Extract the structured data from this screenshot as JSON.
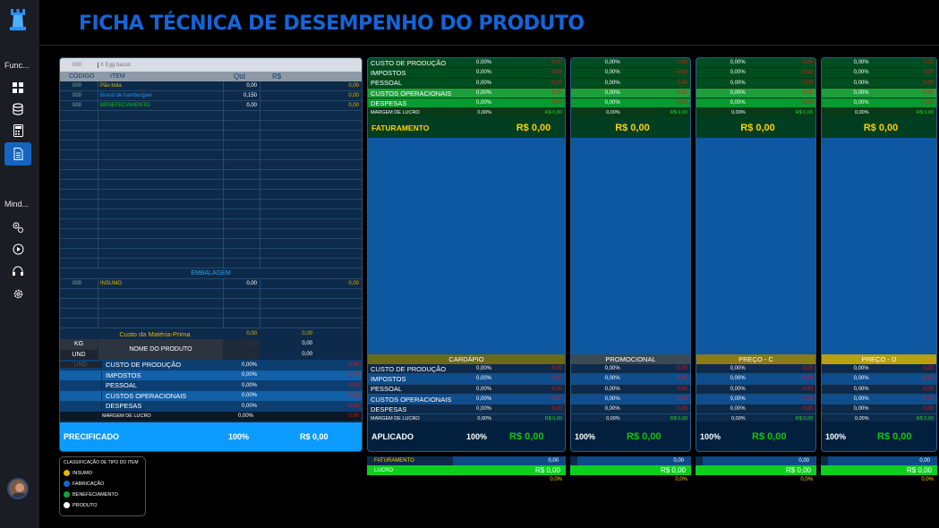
{
  "title": "FICHA TÉCNICA DE DESEMPENHO DO PRODUTO",
  "sidebar": {
    "section1": "Func...",
    "section2": "Mind...",
    "icons1": [
      "grid-icon",
      "database-icon",
      "calculator-icon",
      "document-icon"
    ],
    "icons2": [
      "gears-icon",
      "play-icon",
      "headset-icon",
      "settings-icon"
    ]
  },
  "left_panel": {
    "search_code": "000",
    "search_text": "X Egg bacon",
    "headers": {
      "code": "CÓDIGO",
      "item": "ITEM",
      "qtd": "Qtd",
      "rs": "R$"
    },
    "items": [
      {
        "code": "000",
        "item": "Pão bola",
        "qtd": "0,00",
        "rs": "0,00",
        "color": "#e3b800"
      },
      {
        "code": "000",
        "item": "Brand de hamburguer",
        "qtd": "0,150",
        "rs": "0,00",
        "color": "#2a8ff0"
      },
      {
        "code": "000",
        "item": "BENEFECIAMENTO",
        "qtd": "0,00",
        "rs": "0,00",
        "color": "#11c411"
      }
    ],
    "embalagem_label": "EMBALAGEM",
    "embalagem_items": [
      {
        "code": "000",
        "item": "INSUMO",
        "qtd": "0,00",
        "rs": "0,00"
      }
    ],
    "custo_mp": {
      "label": "Custo da Matéria-Prima",
      "qtd": "0,00",
      "rs": "0,00"
    },
    "unit_labels": [
      "KG",
      "UND",
      "UND"
    ],
    "nome_produto": "NOME DO PRODUTO",
    "kg_values": [
      "0,00",
      "0,00"
    ],
    "und_values": [
      "1",
      "0,00"
    ],
    "costs": [
      {
        "label": "CUSTO DE PRODUÇÃO",
        "pct": "0,00%",
        "val": "0,00"
      },
      {
        "label": "IMPOSTOS",
        "pct": "0,00%",
        "val": "0,00"
      },
      {
        "label": "PESSOAL",
        "pct": "0,00%",
        "val": "0,00"
      },
      {
        "label": "CUSTOS OPERACIONAIS",
        "pct": "0,00%",
        "val": "0,00"
      },
      {
        "label": "DESPESAS",
        "pct": "0,00%",
        "val": "0,00"
      }
    ],
    "margem": {
      "label": "MARGEM DE LUCRO",
      "pct": "0,00%",
      "val": "0,00"
    },
    "footer": {
      "label": "PRECIFICADO",
      "pct": "100%",
      "val": "R$ 0,00"
    }
  },
  "price_columns": [
    {
      "labels": [
        "CUSTO DE PRODUÇÃO",
        "IMPOSTOS",
        "PESSOAL",
        "CUSTOS OPERACIONAIS",
        "DESPESAS"
      ],
      "pcts": [
        "0,00%",
        "0,00%",
        "0,00%",
        "0,00%",
        "0,00%"
      ],
      "vals": [
        "0,00",
        "0,00",
        "0,00",
        "0,00",
        "0,00"
      ],
      "margem_label": "MARGEM DE LUCRO",
      "margem_pct": "0,00%",
      "margem_val": "R$ 0,00",
      "fat_label": "FATURAMENTO",
      "fat_val": "R$ 0,00",
      "bar_title": "CARDÁPIO",
      "bar_color": "#6b6a1a",
      "lower_pcts": [
        "0,00%",
        "0,00%",
        "0,00%",
        "0,00%",
        "0,00%"
      ],
      "lower_vals": [
        "0,00",
        "0,00",
        "0,00",
        "0,00",
        "0,00"
      ],
      "lower_margem_pct": "0,00%",
      "lower_margem_val": "R$ 0,00",
      "footer_label": "APLICADO",
      "footer_pct": "100%",
      "footer_val": "R$ 0,00",
      "sum_fat_label": "FATURAMENTO",
      "sum_fat_val": "0,00",
      "sum_lucro_label": "LUCRO",
      "sum_lucro_val": "R$ 0,00",
      "sum_pct": "0,0%"
    },
    {
      "pcts": [
        "0,00%",
        "0,00%",
        "0,00%",
        "0,00%",
        "0,00%"
      ],
      "vals": [
        "0,00",
        "0,00",
        "0,00",
        "0,00",
        "0,00"
      ],
      "margem_pct": "0,00%",
      "margem_val": "R$ 0,00",
      "fat_val": "R$ 0,00",
      "bar_title": "PROMOCIONAL",
      "bar_color": "#3a4a55",
      "lower_pcts": [
        "0,00%",
        "0,00%",
        "0,00%",
        "0,00%",
        "0,00%"
      ],
      "lower_vals": [
        "0,00",
        "0,00",
        "0,00",
        "0,00",
        "0,00"
      ],
      "lower_margem_pct": "0,00%",
      "lower_margem_val": "R$ 0,00",
      "footer_pct": "100%",
      "footer_val": "R$ 0,00",
      "sum_fat_val": "0,00",
      "sum_lucro_val": "R$ 0,00",
      "sum_pct": "0,0%"
    },
    {
      "pcts": [
        "0,00%",
        "0,00%",
        "0,00%",
        "0,00%",
        "0,00%"
      ],
      "vals": [
        "0,00",
        "0,00",
        "0,00",
        "0,00",
        "0,00"
      ],
      "margem_pct": "0,00%",
      "margem_val": "R$ 0,00",
      "fat_val": "R$ 0,00",
      "bar_title": "PREÇO - C",
      "bar_color": "#8a7a1a",
      "lower_pcts": [
        "0,00%",
        "0,00%",
        "0,00%",
        "0,00%",
        "0,00%"
      ],
      "lower_vals": [
        "0,00",
        "0,00",
        "0,00",
        "0,00",
        "0,00"
      ],
      "lower_margem_pct": "0,00%",
      "lower_margem_val": "R$ 0,00",
      "footer_pct": "100%",
      "footer_val": "R$ 0,00",
      "sum_fat_val": "0,00",
      "sum_lucro_val": "R$ 0,00",
      "sum_pct": "0,0%"
    },
    {
      "pcts": [
        "0,00%",
        "0,00%",
        "0,00%",
        "0,00%",
        "0,00%"
      ],
      "vals": [
        "0,00",
        "0,00",
        "0,00",
        "0,00",
        "0,00"
      ],
      "margem_pct": "0,00%",
      "margem_val": "R$ 0,00",
      "fat_val": "R$ 0,00",
      "bar_title": "PREÇO - D",
      "bar_color": "#b8a010",
      "lower_pcts": [
        "0,00%",
        "0,00%",
        "0,00%",
        "0,00%",
        "0,00%"
      ],
      "lower_vals": [
        "0,00",
        "0,00",
        "0,00",
        "0,00",
        "0,00"
      ],
      "lower_margem_pct": "0,00%",
      "lower_margem_val": "R$ 0,00",
      "footer_pct": "100%",
      "footer_val": "R$ 0,00",
      "sum_fat_val": "0,00",
      "sum_lucro_val": "R$ 0,00",
      "sum_pct": "0,0%"
    }
  ],
  "legend": {
    "title": "CLASSIFICAÇÃO DE TIPO DO ITEM",
    "items": [
      {
        "label": "INSUMO",
        "color": "#e3b800"
      },
      {
        "label": "FABRICAÇÃO",
        "color": "#1565d8"
      },
      {
        "label": "BENEFECIAMENTO",
        "color": "#11a830"
      },
      {
        "label": "PRODUTO",
        "color": "#ffffff"
      }
    ]
  }
}
